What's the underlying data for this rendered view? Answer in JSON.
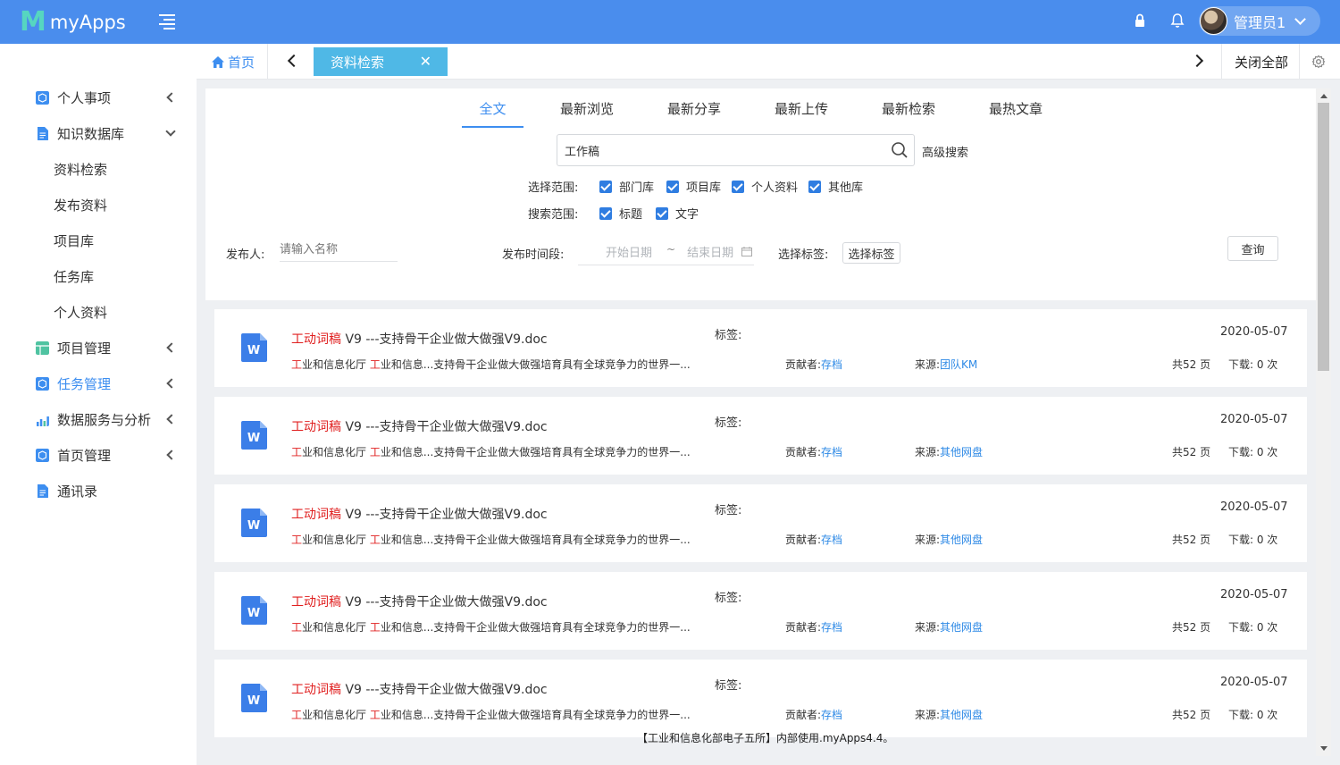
{
  "app": {
    "logo_mark": "M",
    "name": "myApps"
  },
  "header": {
    "user_name": "管理员1"
  },
  "sidebar": {
    "items": [
      {
        "label": "个人事项",
        "icon": "cube-icon",
        "color": "#3d8ef0"
      },
      {
        "label": "知识数据库",
        "icon": "document-icon",
        "color": "#3d8ef0"
      },
      {
        "label": "资料检索"
      },
      {
        "label": "发布资料"
      },
      {
        "label": "项目库"
      },
      {
        "label": "任务库"
      },
      {
        "label": "个人资料"
      },
      {
        "label": "项目管理",
        "icon": "table-icon",
        "color": "#4fc3a1"
      },
      {
        "label": "任务管理",
        "icon": "cube-icon",
        "color": "#3d8ef0"
      },
      {
        "label": "数据服务与分析",
        "icon": "bar-chart-icon",
        "color": "#3d8ef0"
      },
      {
        "label": "首页管理",
        "icon": "cube-icon",
        "color": "#3d8ef0"
      },
      {
        "label": "通讯录",
        "icon": "document-icon",
        "color": "#3d8ef0"
      }
    ]
  },
  "tabs": {
    "home_label": "首页",
    "active_label": "资料检索",
    "close_all_label": "关闭全部"
  },
  "search": {
    "categories": [
      "全文",
      "最新浏览",
      "最新分享",
      "最新上传",
      "最新检索",
      "最热文章"
    ],
    "query": "工作稿",
    "advanced_label": "高级搜索",
    "scope_label": "选择范围:",
    "scope_options": [
      "部门库",
      "项目库",
      "个人资料",
      "其他库"
    ],
    "search_range_label": "搜索范围:",
    "range_options": [
      "标题",
      "文字"
    ],
    "publisher_label": "发布人:",
    "publisher_placeholder": "请输入名称",
    "period_label": "发布时间段:",
    "start_placeholder": "开始日期",
    "end_placeholder": "结束日期",
    "date_separator": "~",
    "tag_label": "选择标签:",
    "tag_button": "选择标签",
    "query_button": "查询"
  },
  "results": [
    {
      "title_hl": "工动词稿",
      "title_rest": " V9 ---支持骨干企业做大做强V9.doc",
      "snippet_hl1": "工",
      "snippet_mid": "业和信息化厅 ",
      "snippet_hl2": "工",
      "snippet_rest": "业和信息...支持骨干企业做大做强培育具有全球竞争力的世界一...",
      "tag_label": "标签:",
      "date": "2020-05-07",
      "contrib_label": "贡献者:",
      "contrib": "存档",
      "source_label": "来源:",
      "source": "团队KM",
      "pages": "共52 页",
      "downloads": "下载:  0 次"
    },
    {
      "title_hl": "工动词稿",
      "title_rest": " V9 ---支持骨干企业做大做强V9.doc",
      "snippet_hl1": "工",
      "snippet_mid": "业和信息化厅 ",
      "snippet_hl2": "工",
      "snippet_rest": "业和信息...支持骨干企业做大做强培育具有全球竞争力的世界一...",
      "tag_label": "标签:",
      "date": "2020-05-07",
      "contrib_label": "贡献者:",
      "contrib": "存档",
      "source_label": "来源:",
      "source": "其他网盘",
      "pages": "共52 页",
      "downloads": "下载:  0 次"
    },
    {
      "title_hl": "工动词稿",
      "title_rest": " V9 ---支持骨干企业做大做强V9.doc",
      "snippet_hl1": "工",
      "snippet_mid": "业和信息化厅 ",
      "snippet_hl2": "工",
      "snippet_rest": "业和信息...支持骨干企业做大做强培育具有全球竞争力的世界一...",
      "tag_label": "标签:",
      "date": "2020-05-07",
      "contrib_label": "贡献者:",
      "contrib": "存档",
      "source_label": "来源:",
      "source": "其他网盘",
      "pages": "共52 页",
      "downloads": "下载:  0 次"
    },
    {
      "title_hl": "工动词稿",
      "title_rest": " V9 ---支持骨干企业做大做强V9.doc",
      "snippet_hl1": "工",
      "snippet_mid": "业和信息化厅 ",
      "snippet_hl2": "工",
      "snippet_rest": "业和信息...支持骨干企业做大做强培育具有全球竞争力的世界一...",
      "tag_label": "标签:",
      "date": "2020-05-07",
      "contrib_label": "贡献者:",
      "contrib": "存档",
      "source_label": "来源:",
      "source": "其他网盘",
      "pages": "共52 页",
      "downloads": "下载:  0 次"
    },
    {
      "title_hl": "工动词稿",
      "title_rest": " V9 ---支持骨干企业做大做强V9.doc",
      "snippet_hl1": "工",
      "snippet_mid": "业和信息化厅 ",
      "snippet_hl2": "工",
      "snippet_rest": "业和信息...支持骨干企业做大做强培育具有全球竞争力的世界一...",
      "tag_label": "标签:",
      "date": "2020-05-07",
      "contrib_label": "贡献者:",
      "contrib": "存档",
      "source_label": "来源:",
      "source": "其他网盘",
      "pages": "共52 页",
      "downloads": "下载:  0 次"
    }
  ],
  "footer": {
    "note": "【工业和信息化部电子五所】内部使用.myApps4.4。"
  },
  "colors": {
    "header": "#4a8ded",
    "accent": "#3d8ef0",
    "highlight": "#e02020",
    "link": "#2f8ae6",
    "tab_active": "#4fb8e6"
  }
}
